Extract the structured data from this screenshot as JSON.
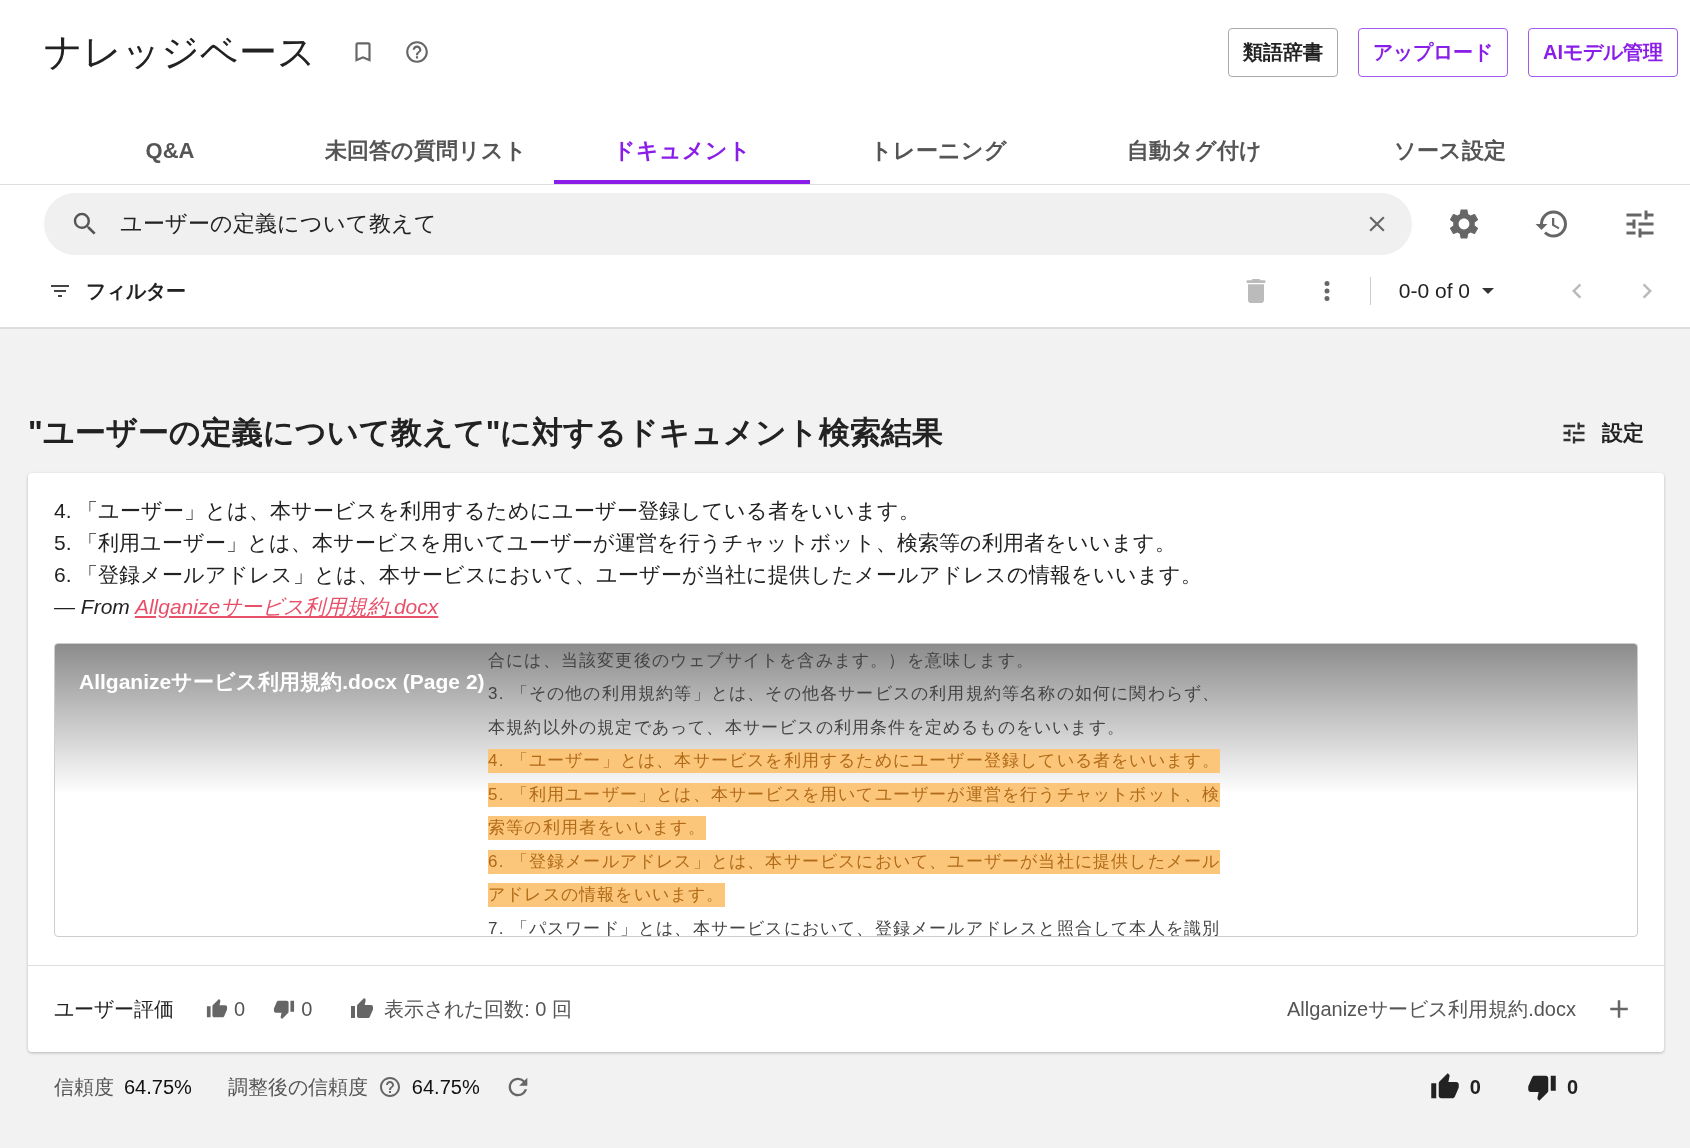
{
  "header": {
    "title": "ナレッジベース",
    "buttons": [
      {
        "label": "類語辞書",
        "kind": "default"
      },
      {
        "label": "アップロード",
        "kind": "primary"
      },
      {
        "label": "AIモデル管理",
        "kind": "primary"
      }
    ]
  },
  "tabs": [
    {
      "label": "Q&A",
      "selected": false
    },
    {
      "label": "未回答の質問リスト",
      "selected": false
    },
    {
      "label": "ドキュメント",
      "selected": true
    },
    {
      "label": "トレーニング",
      "selected": false
    },
    {
      "label": "自動タグ付け",
      "selected": false
    },
    {
      "label": "ソース設定",
      "selected": false
    }
  ],
  "search": {
    "value": "ユーザーの定義について教えて"
  },
  "toolbar": {
    "filter_label": "フィルター",
    "pagination": "0-0 of 0"
  },
  "results": {
    "heading": "\"ユーザーの定義について教えて\"に対するドキュメント検索結果",
    "settings_label": "設定",
    "answer_lines": [
      "4. 「ユーザー」とは、本サービスを利用するためにユーザー登録している者をいいます。",
      "5. 「利用ユーザー」とは、本サービスを用いてユーザーが運営を行うチャットボット、検索等の利用者をいいます。",
      "6. 「登録メールアドレス」とは、本サービスにおいて、ユーザーが当社に提供したメールアドレスの情報をいいます。"
    ],
    "source_prefix": "— From",
    "source_link": "Allganizeサービス利用規約.docx",
    "preview": {
      "title": "Allganizeサービス利用規約.docx (Page 2)",
      "lines": [
        {
          "text": "合には、当該変更後のウェブサイトを含みます。）を意味します。",
          "highlighted": false
        },
        {
          "text": "3. 「その他の利用規約等」とは、その他各サービスの利用規約等名称の如何に関わらず、",
          "highlighted": false
        },
        {
          "text": "本規約以外の規定であって、本サービスの利用条件を定めるものをいいます。",
          "highlighted": false
        },
        {
          "text": "4. 「ユーザー」とは、本サービスを利用するためにユーザー登録している者をいいます。",
          "highlighted": true
        },
        {
          "text": "5. 「利用ユーザー」とは、本サービスを用いてユーザーが運営を行うチャットボット、検",
          "highlighted": true
        },
        {
          "text": "索等の利用者をいいます。",
          "highlighted": true
        },
        {
          "text": "6. 「登録メールアドレス」とは、本サービスにおいて、ユーザーが当社に提供したメール",
          "highlighted": true
        },
        {
          "text": "アドレスの情報をいいます。",
          "highlighted": true
        },
        {
          "text": "7. 「パスワード」とは、本サービスにおいて、登録メールアドレスと照合して本人を識別",
          "highlighted": false
        }
      ]
    },
    "rating_label": "ユーザー評価",
    "likes": "0",
    "dislikes": "0",
    "views": "表示された回数: 0 回",
    "file_name": "Allganizeサービス利用規約.docx",
    "confidence_label": "信頼度",
    "confidence": "64.75%",
    "adjusted_label": "調整後の信頼度",
    "adjusted": "64.75%",
    "total_likes": "0",
    "total_dislikes": "0"
  }
}
